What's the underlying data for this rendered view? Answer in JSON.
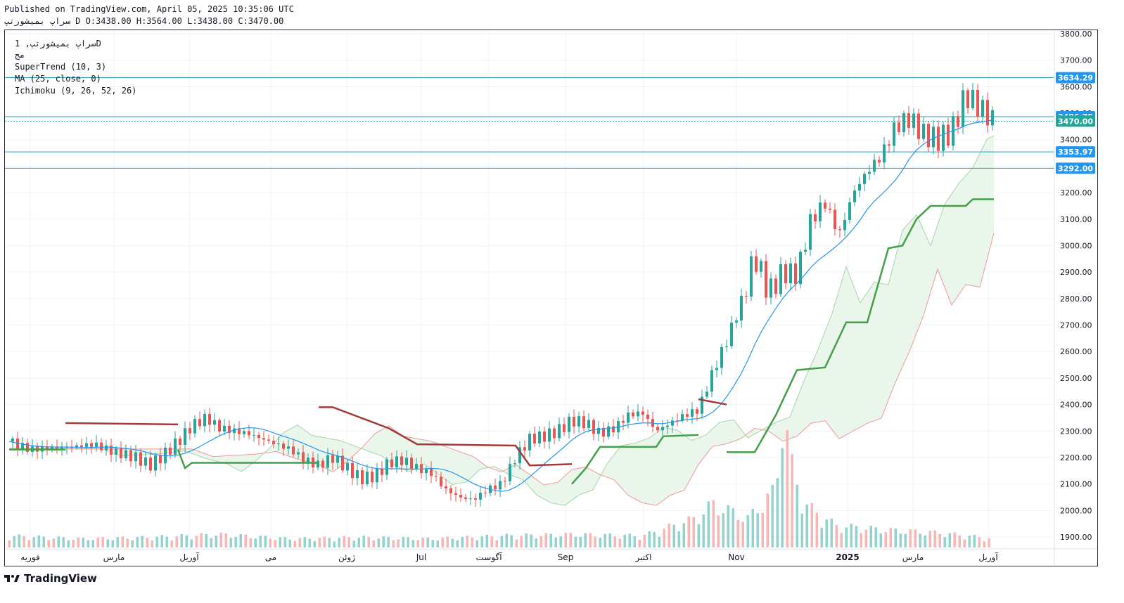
{
  "header": {
    "published": "Published on TradingView.com, April 05, 2025 10:35:06 UTC",
    "ohlc": "سراپ بمیشورتپ D O:3438.00 H:3564.00 L:3438.00 C:3470.00"
  },
  "legend": {
    "symbol": "سراپ بمیشورتپ, 1D",
    "exchange": "مج",
    "supertrend": "SuperTrend (10, 3)",
    "ma": "MA (25, close, 0)",
    "ichimoku": "Ichimoku (9, 26, 52, 26)"
  },
  "brand": "TradingView",
  "colors": {
    "up": "#26a69a",
    "down": "#ef5350",
    "ma": "#2196f3",
    "st_up": "#43a047",
    "st_down": "#a33a3a",
    "hline": "#2a9bb5",
    "tag": "#2196f3"
  },
  "chart_data": {
    "type": "candlestick",
    "title": "",
    "price_axis": [
      "3800.00",
      "3700.00",
      "3600.00",
      "3500.00",
      "3400.00",
      "3300.00",
      "3200.00",
      "3100.00",
      "3000.00",
      "2900.00",
      "2800.00",
      "2700.00",
      "2600.00",
      "2500.00",
      "2400.00",
      "2300.00",
      "2200.00",
      "2100.00",
      "2000.00",
      "1900.00"
    ],
    "ylim": [
      1870,
      3830
    ],
    "date_axis": [
      "فوریه",
      "مارس",
      "آوریل",
      "می",
      "ژوئن",
      "Jul",
      "آگوست",
      "Sep",
      "اکتبر",
      "Nov",
      "2025",
      "مارس",
      "آوریل"
    ],
    "price_tags": [
      {
        "label": "3634.29",
        "value": 3634.29
      },
      {
        "label": "3486.75",
        "value": 3486.75
      },
      {
        "label": "3470.00",
        "value": 3470.0
      },
      {
        "label": "3353.97",
        "value": 3353.97
      },
      {
        "label": "3292.00",
        "value": 3292.0
      }
    ],
    "close_path": [
      [
        0,
        2260
      ],
      [
        6,
        2230
      ],
      [
        12,
        2235
      ],
      [
        18,
        2240
      ],
      [
        24,
        2250
      ],
      [
        30,
        2220
      ],
      [
        36,
        2200
      ],
      [
        40,
        2170
      ],
      [
        44,
        2210
      ],
      [
        48,
        2260
      ],
      [
        52,
        2320
      ],
      [
        56,
        2350
      ],
      [
        60,
        2310
      ],
      [
        64,
        2300
      ],
      [
        68,
        2290
      ],
      [
        72,
        2270
      ],
      [
        76,
        2250
      ],
      [
        80,
        2230
      ],
      [
        84,
        2190
      ],
      [
        88,
        2170
      ],
      [
        92,
        2200
      ],
      [
        96,
        2160
      ],
      [
        100,
        2120
      ],
      [
        104,
        2130
      ],
      [
        108,
        2180
      ],
      [
        112,
        2190
      ],
      [
        116,
        2160
      ],
      [
        120,
        2140
      ],
      [
        124,
        2080
      ],
      [
        128,
        2050
      ],
      [
        132,
        2040
      ],
      [
        136,
        2080
      ],
      [
        140,
        2100
      ],
      [
        144,
        2200
      ],
      [
        148,
        2270
      ],
      [
        152,
        2280
      ],
      [
        156,
        2300
      ],
      [
        160,
        2340
      ],
      [
        164,
        2330
      ],
      [
        168,
        2290
      ],
      [
        172,
        2310
      ],
      [
        176,
        2360
      ],
      [
        180,
        2370
      ],
      [
        184,
        2300
      ],
      [
        188,
        2330
      ],
      [
        192,
        2360
      ],
      [
        196,
        2380
      ],
      [
        200,
        2520
      ],
      [
        204,
        2640
      ],
      [
        208,
        2780
      ],
      [
        212,
        2960
      ],
      [
        216,
        2820
      ],
      [
        220,
        2900
      ],
      [
        224,
        2890
      ],
      [
        228,
        3100
      ],
      [
        232,
        3160
      ],
      [
        236,
        3040
      ],
      [
        240,
        3200
      ],
      [
        244,
        3280
      ],
      [
        248,
        3340
      ],
      [
        252,
        3450
      ],
      [
        256,
        3480
      ],
      [
        260,
        3420
      ],
      [
        264,
        3400
      ],
      [
        268,
        3430
      ],
      [
        272,
        3570
      ],
      [
        276,
        3520
      ],
      [
        280,
        3470
      ]
    ],
    "volume_path": [
      [
        0,
        0.08
      ],
      [
        20,
        0.06
      ],
      [
        40,
        0.07
      ],
      [
        60,
        0.09
      ],
      [
        80,
        0.06
      ],
      [
        100,
        0.07
      ],
      [
        120,
        0.06
      ],
      [
        140,
        0.08
      ],
      [
        160,
        0.09
      ],
      [
        180,
        0.08
      ],
      [
        195,
        0.2
      ],
      [
        200,
        0.3
      ],
      [
        205,
        0.25
      ],
      [
        210,
        0.2
      ],
      [
        218,
        0.4
      ],
      [
        220,
        1.0
      ],
      [
        222,
        0.6
      ],
      [
        226,
        0.3
      ],
      [
        235,
        0.15
      ],
      [
        250,
        0.12
      ],
      [
        265,
        0.1
      ],
      [
        280,
        0.06
      ]
    ]
  }
}
